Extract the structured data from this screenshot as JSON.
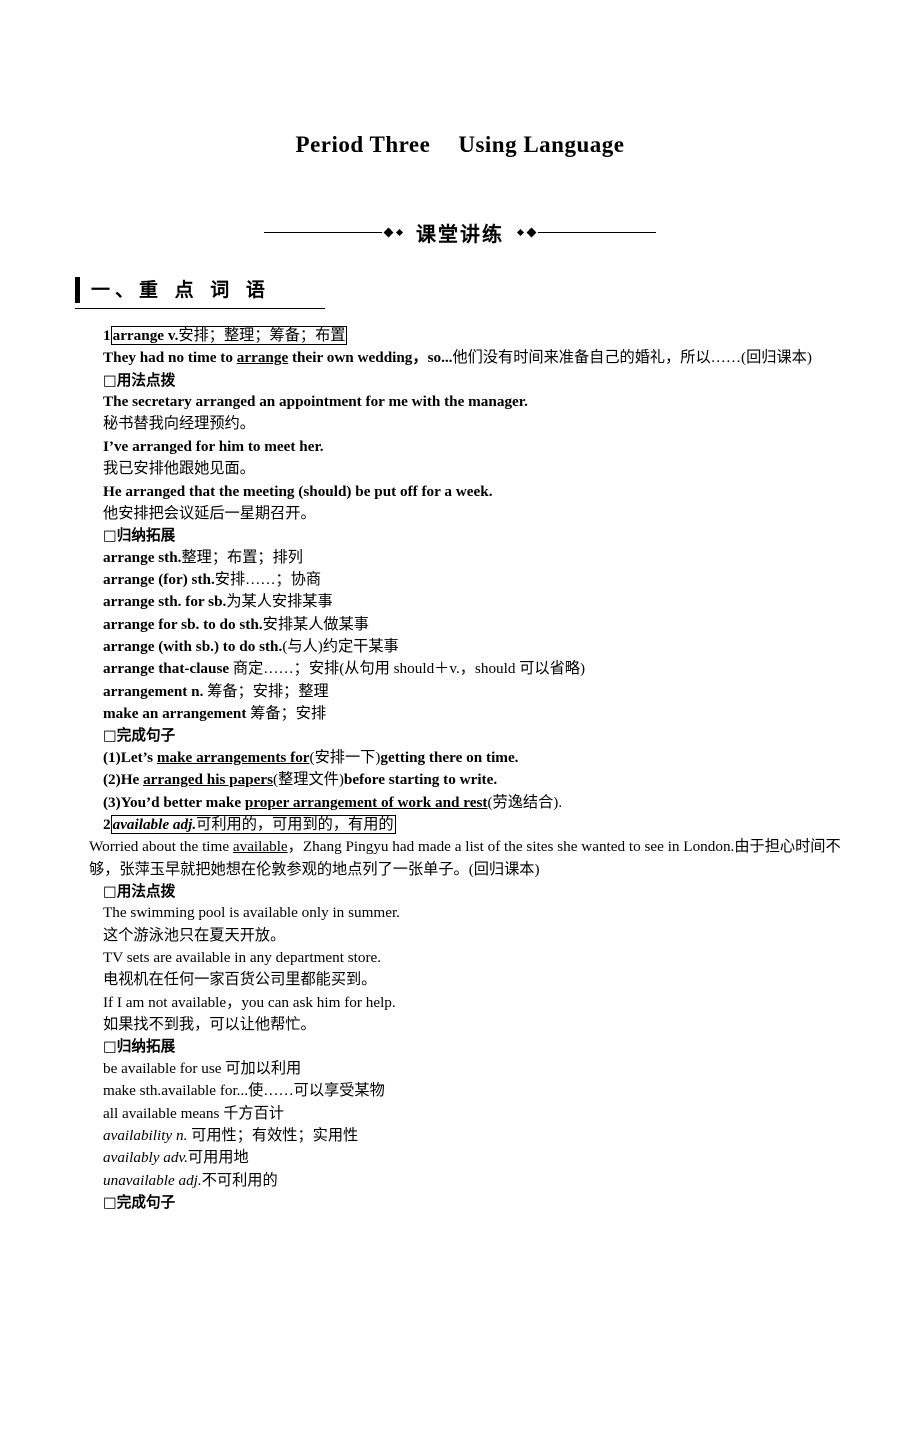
{
  "title": {
    "part1": "Period Three",
    "part2": "Using Language"
  },
  "banner": {
    "text": "课堂讲练"
  },
  "section": {
    "heading": "一、重 点 词 语"
  },
  "entries": [
    {
      "number": "1",
      "headword": "arrange v.",
      "headword_gloss": "安排；整理；筹备；布置",
      "quote_en": "They had no time to ",
      "quote_underline": "arrange",
      "quote_en2": " their own wedding，so...",
      "quote_cn": "他们没有时间来准备自己的婚礼，所以……(回归课本)",
      "usage_label": "□用法点拨",
      "usage": [
        {
          "en": "The secretary arranged an appointment for me with the manager.",
          "cn": "秘书替我向经理预约。"
        },
        {
          "en": "I’ve arranged for him to meet her.",
          "cn": "我已安排他跟她见面。"
        },
        {
          "en": "He arranged that the meeting (should) be put off for a week.",
          "cn": "他安排把会议延后一星期召开。"
        }
      ],
      "expand_label": "□归纳拓展",
      "expansions": [
        {
          "term": "arrange sth.",
          "gloss": "整理；布置；排列"
        },
        {
          "term": "arrange (for) sth.",
          "gloss": "安排……；协商"
        },
        {
          "term": "arrange sth. for sb.",
          "gloss": "为某人安排某事"
        },
        {
          "term": "arrange for sb. to do sth.",
          "gloss": "安排某人做某事"
        },
        {
          "term": "arrange (with sb.) to do sth.",
          "gloss": "(与人)约定干某事"
        },
        {
          "term": "arrange that-clause",
          "gloss": " 商定……；安排(从句用 should＋v.，should 可以省略)"
        },
        {
          "term": "arrangement n.",
          "gloss": " 筹备；安排；整理"
        },
        {
          "term": "make an arrangement",
          "gloss": " 筹备；安排"
        }
      ],
      "sentence_label": "□完成句子",
      "sentences": [
        {
          "no": "(1)",
          "pre": "Let’s ",
          "blank": "make  arrangements  for",
          "hint": "(安排一下)",
          "post": "getting there on time."
        },
        {
          "no": "(2)",
          "pre": "He ",
          "blank": "arranged  his  papers",
          "hint": "(整理文件)",
          "post": "before starting to write."
        },
        {
          "no": "(3)",
          "pre": "You’d better make ",
          "blank": "proper  arrangement  of  work  and  rest",
          "hint": "(劳逸结合).",
          "post": ""
        }
      ]
    },
    {
      "number": "2",
      "headword": "available adj.",
      "headword_gloss": "可利用的，可用到的，有用的",
      "quote_en": "Worried about the time ",
      "quote_underline": "available",
      "quote_en2": "，Zhang Pingyu had made a list of the sites she wanted to see in London.",
      "quote_cn": "由于担心时间不够，张萍玉早就把她想在伦敦参观的地点列了一张单子。(回归课本)",
      "usage_label": "□用法点拨",
      "usage": [
        {
          "en": "The swimming pool is available only in summer.",
          "cn": "这个游泳池只在夏天开放。"
        },
        {
          "en": "TV sets are available in any department store.",
          "cn": "电视机在任何一家百货公司里都能买到。"
        },
        {
          "en": "If I am not available，you can ask him for help.",
          "cn": "如果找不到我，可以让他帮忙。"
        }
      ],
      "expand_label": "□归纳拓展",
      "expansions": [
        {
          "term": "be available for use",
          "gloss": " 可加以利用"
        },
        {
          "term": "make sth.available for...",
          "gloss": "使……可以享受某物"
        },
        {
          "term": "all available means",
          "gloss": " 千方百计"
        },
        {
          "term": "availability n.",
          "gloss": " 可用性；有效性；实用性"
        },
        {
          "term": "availably adv.",
          "gloss": "可用用地"
        },
        {
          "term": "unavailable adj.",
          "gloss": "不可利用的"
        }
      ],
      "sentence_label": "□完成句子"
    }
  ]
}
